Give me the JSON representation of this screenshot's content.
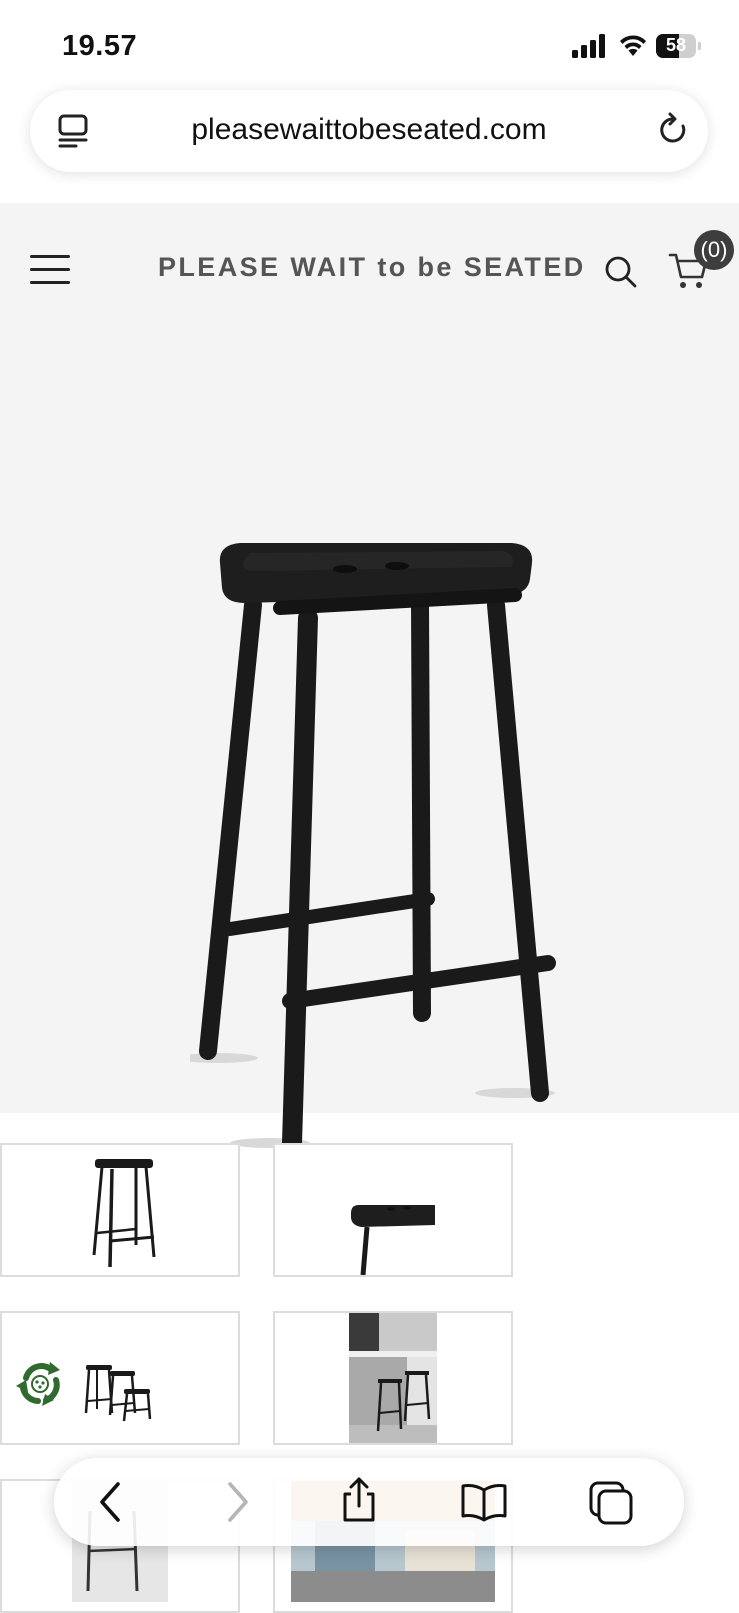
{
  "status_bar": {
    "time": "19.57",
    "battery": "58"
  },
  "browser": {
    "url": "pleasewaittobeseated.com",
    "icons": {
      "reader": "reader-icon",
      "reload": "reload-icon",
      "back": "back-arrow-icon",
      "forward": "forward-arrow-icon",
      "share": "share-icon",
      "bookmarks": "bookmarks-icon",
      "tabs": "tabs-icon"
    }
  },
  "site": {
    "brand": "PLEASE WAIT to be SEATED",
    "cart_count": "(0)",
    "icons": {
      "menu": "menu-icon",
      "search": "search-icon",
      "cart": "cart-icon"
    }
  },
  "colors": {
    "page_background": "#f4f4f4",
    "brand_text": "#555555",
    "badge": "#3d3d3d",
    "stool": "#1a1a1a",
    "recycle": "#2f6b2f"
  }
}
